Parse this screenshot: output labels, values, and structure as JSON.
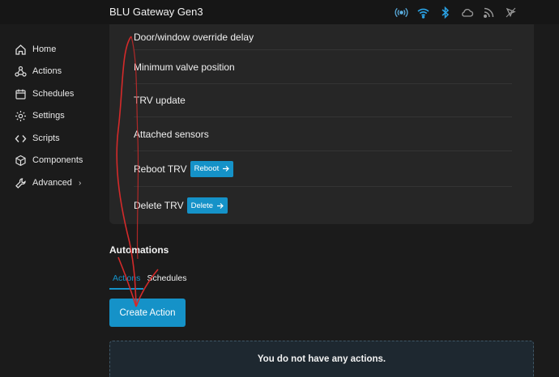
{
  "header": {
    "title": "BLU Gateway Gen3",
    "icons": [
      "radio-icon",
      "wifi-icon",
      "bluetooth-icon",
      "cloud-icon",
      "rss-icon",
      "pointer-icon"
    ]
  },
  "sidebar": {
    "items": [
      {
        "label": "Home",
        "icon": "home-icon"
      },
      {
        "label": "Actions",
        "icon": "actions-icon"
      },
      {
        "label": "Schedules",
        "icon": "calendar-icon"
      },
      {
        "label": "Settings",
        "icon": "gear-icon"
      },
      {
        "label": "Scripts",
        "icon": "code-icon"
      },
      {
        "label": "Components",
        "icon": "cube-icon"
      },
      {
        "label": "Advanced",
        "icon": "wrench-icon",
        "chevron": "›"
      }
    ]
  },
  "settings_list": {
    "items": [
      {
        "label": "Door/window override delay"
      },
      {
        "label": "Minimum valve position"
      },
      {
        "label": "TRV update"
      },
      {
        "label": "Attached sensors"
      },
      {
        "label": "Reboot TRV",
        "button": "Reboot"
      },
      {
        "label": "Delete TRV",
        "button": "Delete"
      }
    ]
  },
  "automations": {
    "title": "Automations",
    "tabs": [
      {
        "label": "Actions",
        "active": true
      },
      {
        "label": "Schedules",
        "active": false
      }
    ],
    "create_button": "Create Action",
    "empty_message": "You do not have any actions."
  },
  "colors": {
    "accent": "#1592c8",
    "background": "#1b1b1b",
    "card": "#262626",
    "annotation": "#d42a2a"
  }
}
